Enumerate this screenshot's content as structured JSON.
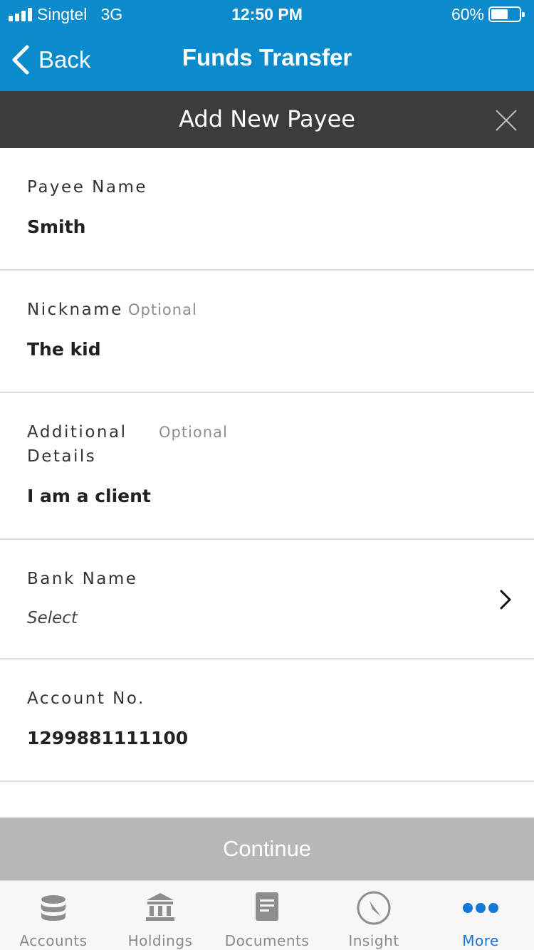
{
  "status_bar": {
    "carrier": "Singtel",
    "network": "3G",
    "time": "12:50 PM",
    "battery": "60%",
    "battery_level": 0.6
  },
  "nav": {
    "back_label": "Back",
    "title": "Funds Transfer"
  },
  "sheet": {
    "title": "Add New Payee"
  },
  "form": {
    "payee_name": {
      "label": "Payee Name",
      "value": "Smith"
    },
    "nickname": {
      "label": "Nickname",
      "optional": "Optional",
      "value": "The kid"
    },
    "additional_details": {
      "label_line1": "Additional",
      "label_line2": "Details",
      "optional": "Optional",
      "value": "I am a client"
    },
    "bank_name": {
      "label": "Bank Name",
      "placeholder": "Select"
    },
    "account_no": {
      "label": "Account No.",
      "value": "1299881111100"
    }
  },
  "continue_label": "Continue",
  "tabs": [
    {
      "label": "Accounts",
      "icon": "database-icon",
      "active": false
    },
    {
      "label": "Holdings",
      "icon": "bank-icon",
      "active": false
    },
    {
      "label": "Documents",
      "icon": "document-icon",
      "active": false
    },
    {
      "label": "Insight",
      "icon": "compass-icon",
      "active": false
    },
    {
      "label": "More",
      "icon": "more-dots-icon",
      "active": true
    }
  ],
  "colors": {
    "header_blue": "#0b8bcb",
    "sheet_header": "#3c3c3c",
    "active_tab": "#1479d6",
    "button_disabled": "#b7b7b7"
  }
}
